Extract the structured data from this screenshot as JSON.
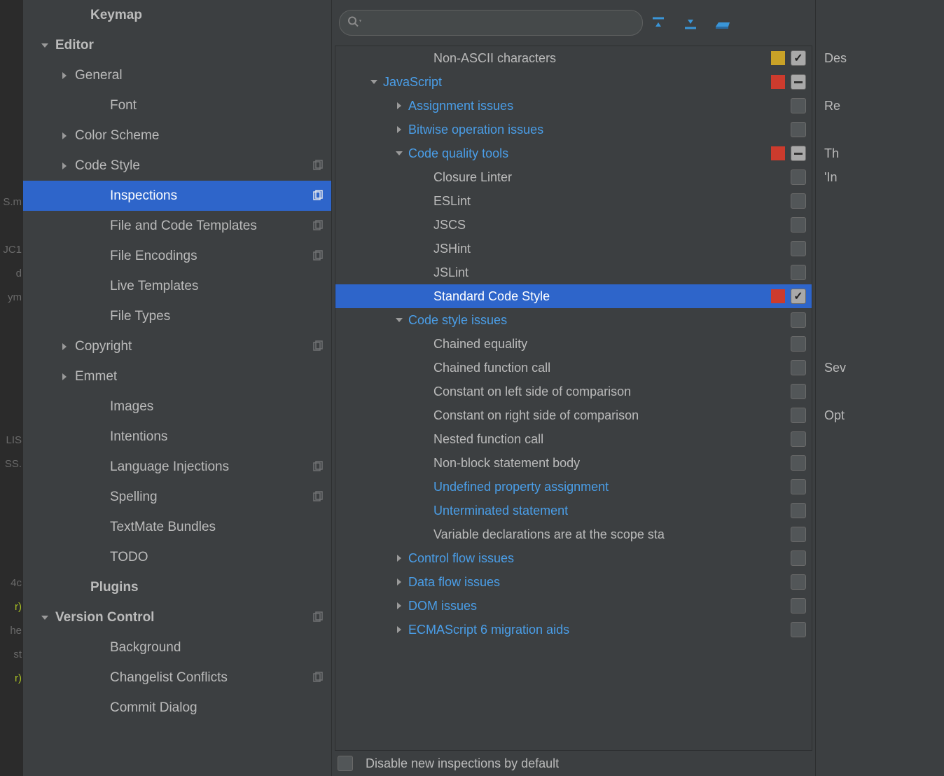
{
  "gutter": {
    "items": [
      {
        "t": "",
        "c": ""
      },
      {
        "t": "",
        "c": ""
      },
      {
        "t": "",
        "c": ""
      },
      {
        "t": "",
        "c": ""
      },
      {
        "t": "",
        "c": ""
      },
      {
        "t": "",
        "c": ""
      },
      {
        "t": "",
        "c": ""
      },
      {
        "t": "",
        "c": ""
      },
      {
        "t": "S.m",
        "c": ""
      },
      {
        "t": "",
        "c": ""
      },
      {
        "t": "JC1",
        "c": ""
      },
      {
        "t": "d",
        "c": ""
      },
      {
        "t": "ym",
        "c": ""
      },
      {
        "t": "",
        "c": ""
      },
      {
        "t": "",
        "c": ""
      },
      {
        "t": "",
        "c": ""
      },
      {
        "t": "",
        "c": ""
      },
      {
        "t": "",
        "c": ""
      },
      {
        "t": "LIS",
        "c": ""
      },
      {
        "t": "SS.",
        "c": ""
      },
      {
        "t": "",
        "c": ""
      },
      {
        "t": "",
        "c": ""
      },
      {
        "t": "",
        "c": ""
      },
      {
        "t": "",
        "c": ""
      },
      {
        "t": "4c",
        "c": ""
      },
      {
        "t": "r)",
        "c": "gy"
      },
      {
        "t": "he",
        "c": ""
      },
      {
        "t": "st",
        "c": ""
      },
      {
        "t": "r)",
        "c": "gy"
      },
      {
        "t": "",
        "c": ""
      }
    ]
  },
  "sidebar": {
    "items": [
      {
        "label": "Keymap",
        "depth": 1,
        "arrow": "none",
        "bold": true,
        "copy": false,
        "selected": false
      },
      {
        "label": "Editor",
        "depth": 0,
        "arrow": "down",
        "bold": true,
        "copy": false,
        "selected": false
      },
      {
        "label": "General",
        "depth": 1,
        "arrow": "right",
        "bold": false,
        "copy": false,
        "selected": false
      },
      {
        "label": "Font",
        "depth": 2,
        "arrow": "none",
        "bold": false,
        "copy": false,
        "selected": false
      },
      {
        "label": "Color Scheme",
        "depth": 1,
        "arrow": "right",
        "bold": false,
        "copy": false,
        "selected": false
      },
      {
        "label": "Code Style",
        "depth": 1,
        "arrow": "right",
        "bold": false,
        "copy": true,
        "selected": false
      },
      {
        "label": "Inspections",
        "depth": 2,
        "arrow": "none",
        "bold": false,
        "copy": true,
        "selected": true
      },
      {
        "label": "File and Code Templates",
        "depth": 2,
        "arrow": "none",
        "bold": false,
        "copy": true,
        "selected": false
      },
      {
        "label": "File Encodings",
        "depth": 2,
        "arrow": "none",
        "bold": false,
        "copy": true,
        "selected": false
      },
      {
        "label": "Live Templates",
        "depth": 2,
        "arrow": "none",
        "bold": false,
        "copy": false,
        "selected": false
      },
      {
        "label": "File Types",
        "depth": 2,
        "arrow": "none",
        "bold": false,
        "copy": false,
        "selected": false
      },
      {
        "label": "Copyright",
        "depth": 1,
        "arrow": "right",
        "bold": false,
        "copy": true,
        "selected": false
      },
      {
        "label": "Emmet",
        "depth": 1,
        "arrow": "right",
        "bold": false,
        "copy": false,
        "selected": false
      },
      {
        "label": "Images",
        "depth": 2,
        "arrow": "none",
        "bold": false,
        "copy": false,
        "selected": false
      },
      {
        "label": "Intentions",
        "depth": 2,
        "arrow": "none",
        "bold": false,
        "copy": false,
        "selected": false
      },
      {
        "label": "Language Injections",
        "depth": 2,
        "arrow": "none",
        "bold": false,
        "copy": true,
        "selected": false
      },
      {
        "label": "Spelling",
        "depth": 2,
        "arrow": "none",
        "bold": false,
        "copy": true,
        "selected": false
      },
      {
        "label": "TextMate Bundles",
        "depth": 2,
        "arrow": "none",
        "bold": false,
        "copy": false,
        "selected": false
      },
      {
        "label": "TODO",
        "depth": 2,
        "arrow": "none",
        "bold": false,
        "copy": false,
        "selected": false
      },
      {
        "label": "Plugins",
        "depth": 1,
        "arrow": "none",
        "bold": true,
        "copy": false,
        "selected": false
      },
      {
        "label": "Version Control",
        "depth": 0,
        "arrow": "down",
        "bold": true,
        "copy": true,
        "selected": false
      },
      {
        "label": "Background",
        "depth": 2,
        "arrow": "none",
        "bold": false,
        "copy": false,
        "selected": false
      },
      {
        "label": "Changelist Conflicts",
        "depth": 2,
        "arrow": "none",
        "bold": false,
        "copy": true,
        "selected": false
      },
      {
        "label": "Commit Dialog",
        "depth": 2,
        "arrow": "none",
        "bold": false,
        "copy": false,
        "selected": false
      }
    ]
  },
  "toolbar": {
    "search_placeholder": ""
  },
  "tree": {
    "rows": [
      {
        "label": "Non-ASCII characters",
        "depth": 3,
        "arrow": "none",
        "link": false,
        "sev": "#c9a227",
        "cb": "checked",
        "selected": false
      },
      {
        "label": "JavaScript",
        "depth": 1,
        "arrow": "down",
        "link": true,
        "sev": "#cc3b2d",
        "cb": "dash",
        "selected": false
      },
      {
        "label": "Assignment issues",
        "depth": 2,
        "arrow": "right",
        "link": true,
        "sev": null,
        "cb": "empty",
        "selected": false
      },
      {
        "label": "Bitwise operation issues",
        "depth": 2,
        "arrow": "right",
        "link": true,
        "sev": null,
        "cb": "empty",
        "selected": false
      },
      {
        "label": "Code quality tools",
        "depth": 2,
        "arrow": "down",
        "link": true,
        "sev": "#cc3b2d",
        "cb": "dash",
        "selected": false
      },
      {
        "label": "Closure Linter",
        "depth": 3,
        "arrow": "none",
        "link": false,
        "sev": null,
        "cb": "empty",
        "selected": false
      },
      {
        "label": "ESLint",
        "depth": 3,
        "arrow": "none",
        "link": false,
        "sev": null,
        "cb": "empty",
        "selected": false
      },
      {
        "label": "JSCS",
        "depth": 3,
        "arrow": "none",
        "link": false,
        "sev": null,
        "cb": "empty",
        "selected": false
      },
      {
        "label": "JSHint",
        "depth": 3,
        "arrow": "none",
        "link": false,
        "sev": null,
        "cb": "empty",
        "selected": false
      },
      {
        "label": "JSLint",
        "depth": 3,
        "arrow": "none",
        "link": false,
        "sev": null,
        "cb": "empty",
        "selected": false
      },
      {
        "label": "Standard Code Style",
        "depth": 3,
        "arrow": "none",
        "link": false,
        "sev": "#cc3b2d",
        "cb": "checked",
        "selected": true
      },
      {
        "label": "Code style issues",
        "depth": 2,
        "arrow": "down",
        "link": true,
        "sev": null,
        "cb": "empty",
        "selected": false
      },
      {
        "label": "Chained equality",
        "depth": 3,
        "arrow": "none",
        "link": false,
        "sev": null,
        "cb": "empty",
        "selected": false
      },
      {
        "label": "Chained function call",
        "depth": 3,
        "arrow": "none",
        "link": false,
        "sev": null,
        "cb": "empty",
        "selected": false
      },
      {
        "label": "Constant on left side of comparison",
        "depth": 3,
        "arrow": "none",
        "link": false,
        "sev": null,
        "cb": "empty",
        "selected": false
      },
      {
        "label": "Constant on right side of comparison",
        "depth": 3,
        "arrow": "none",
        "link": false,
        "sev": null,
        "cb": "empty",
        "selected": false
      },
      {
        "label": "Nested function call",
        "depth": 3,
        "arrow": "none",
        "link": false,
        "sev": null,
        "cb": "empty",
        "selected": false
      },
      {
        "label": "Non-block statement body",
        "depth": 3,
        "arrow": "none",
        "link": false,
        "sev": null,
        "cb": "empty",
        "selected": false
      },
      {
        "label": "Undefined property assignment",
        "depth": 3,
        "arrow": "none",
        "link": true,
        "sev": null,
        "cb": "empty",
        "selected": false
      },
      {
        "label": "Unterminated statement",
        "depth": 3,
        "arrow": "none",
        "link": true,
        "sev": null,
        "cb": "empty",
        "selected": false
      },
      {
        "label": "Variable declarations are at the scope sta",
        "depth": 3,
        "arrow": "none",
        "link": false,
        "sev": null,
        "cb": "empty",
        "selected": false
      },
      {
        "label": "Control flow issues",
        "depth": 2,
        "arrow": "right",
        "link": true,
        "sev": null,
        "cb": "empty",
        "selected": false
      },
      {
        "label": "Data flow issues",
        "depth": 2,
        "arrow": "right",
        "link": true,
        "sev": null,
        "cb": "empty",
        "selected": false
      },
      {
        "label": "DOM issues",
        "depth": 2,
        "arrow": "right",
        "link": true,
        "sev": null,
        "cb": "empty",
        "selected": false
      },
      {
        "label": "ECMAScript 6 migration aids",
        "depth": 2,
        "arrow": "right",
        "link": true,
        "sev": null,
        "cb": "empty",
        "selected": false
      }
    ]
  },
  "footer": {
    "disable_label": "Disable new inspections by default"
  },
  "right_panel": {
    "items": [
      "Des",
      "",
      "Re",
      "",
      "Th",
      "'In",
      "",
      "",
      "",
      "",
      "",
      "",
      "",
      "Sev",
      "",
      "Opt"
    ]
  },
  "colors": {
    "selection": "#2e65ca",
    "link": "#4a9ee8"
  }
}
